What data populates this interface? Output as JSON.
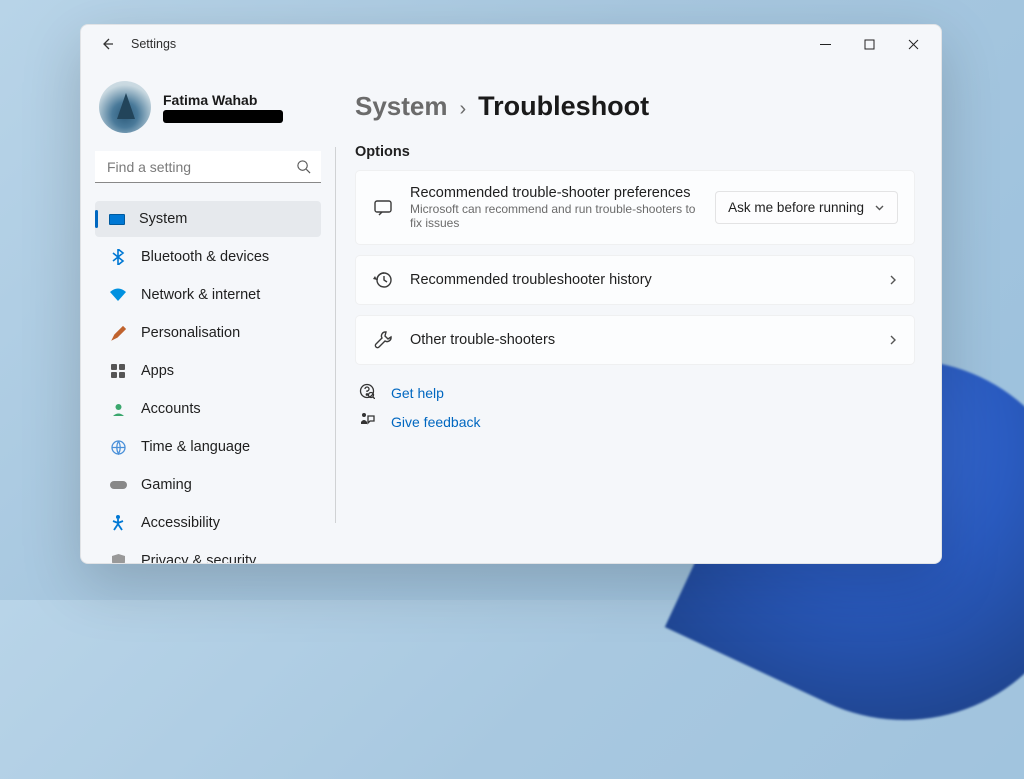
{
  "app": {
    "title": "Settings"
  },
  "profile": {
    "name": "Fatima Wahab"
  },
  "search": {
    "placeholder": "Find a setting"
  },
  "sidebar": {
    "items": [
      {
        "label": "System"
      },
      {
        "label": "Bluetooth & devices"
      },
      {
        "label": "Network & internet"
      },
      {
        "label": "Personalisation"
      },
      {
        "label": "Apps"
      },
      {
        "label": "Accounts"
      },
      {
        "label": "Time & language"
      },
      {
        "label": "Gaming"
      },
      {
        "label": "Accessibility"
      },
      {
        "label": "Privacy & security"
      }
    ]
  },
  "breadcrumb": {
    "parent": "System",
    "sep": "›",
    "current": "Troubleshoot"
  },
  "main": {
    "options_label": "Options",
    "card1": {
      "title": "Recommended trouble-shooter preferences",
      "sub": "Microsoft can recommend and run trouble-shooters to fix issues",
      "dropdown_value": "Ask me before running"
    },
    "card2": {
      "title": "Recommended troubleshooter history"
    },
    "card3": {
      "title": "Other trouble-shooters"
    }
  },
  "help": {
    "get_help": "Get help",
    "give_feedback": "Give feedback"
  }
}
